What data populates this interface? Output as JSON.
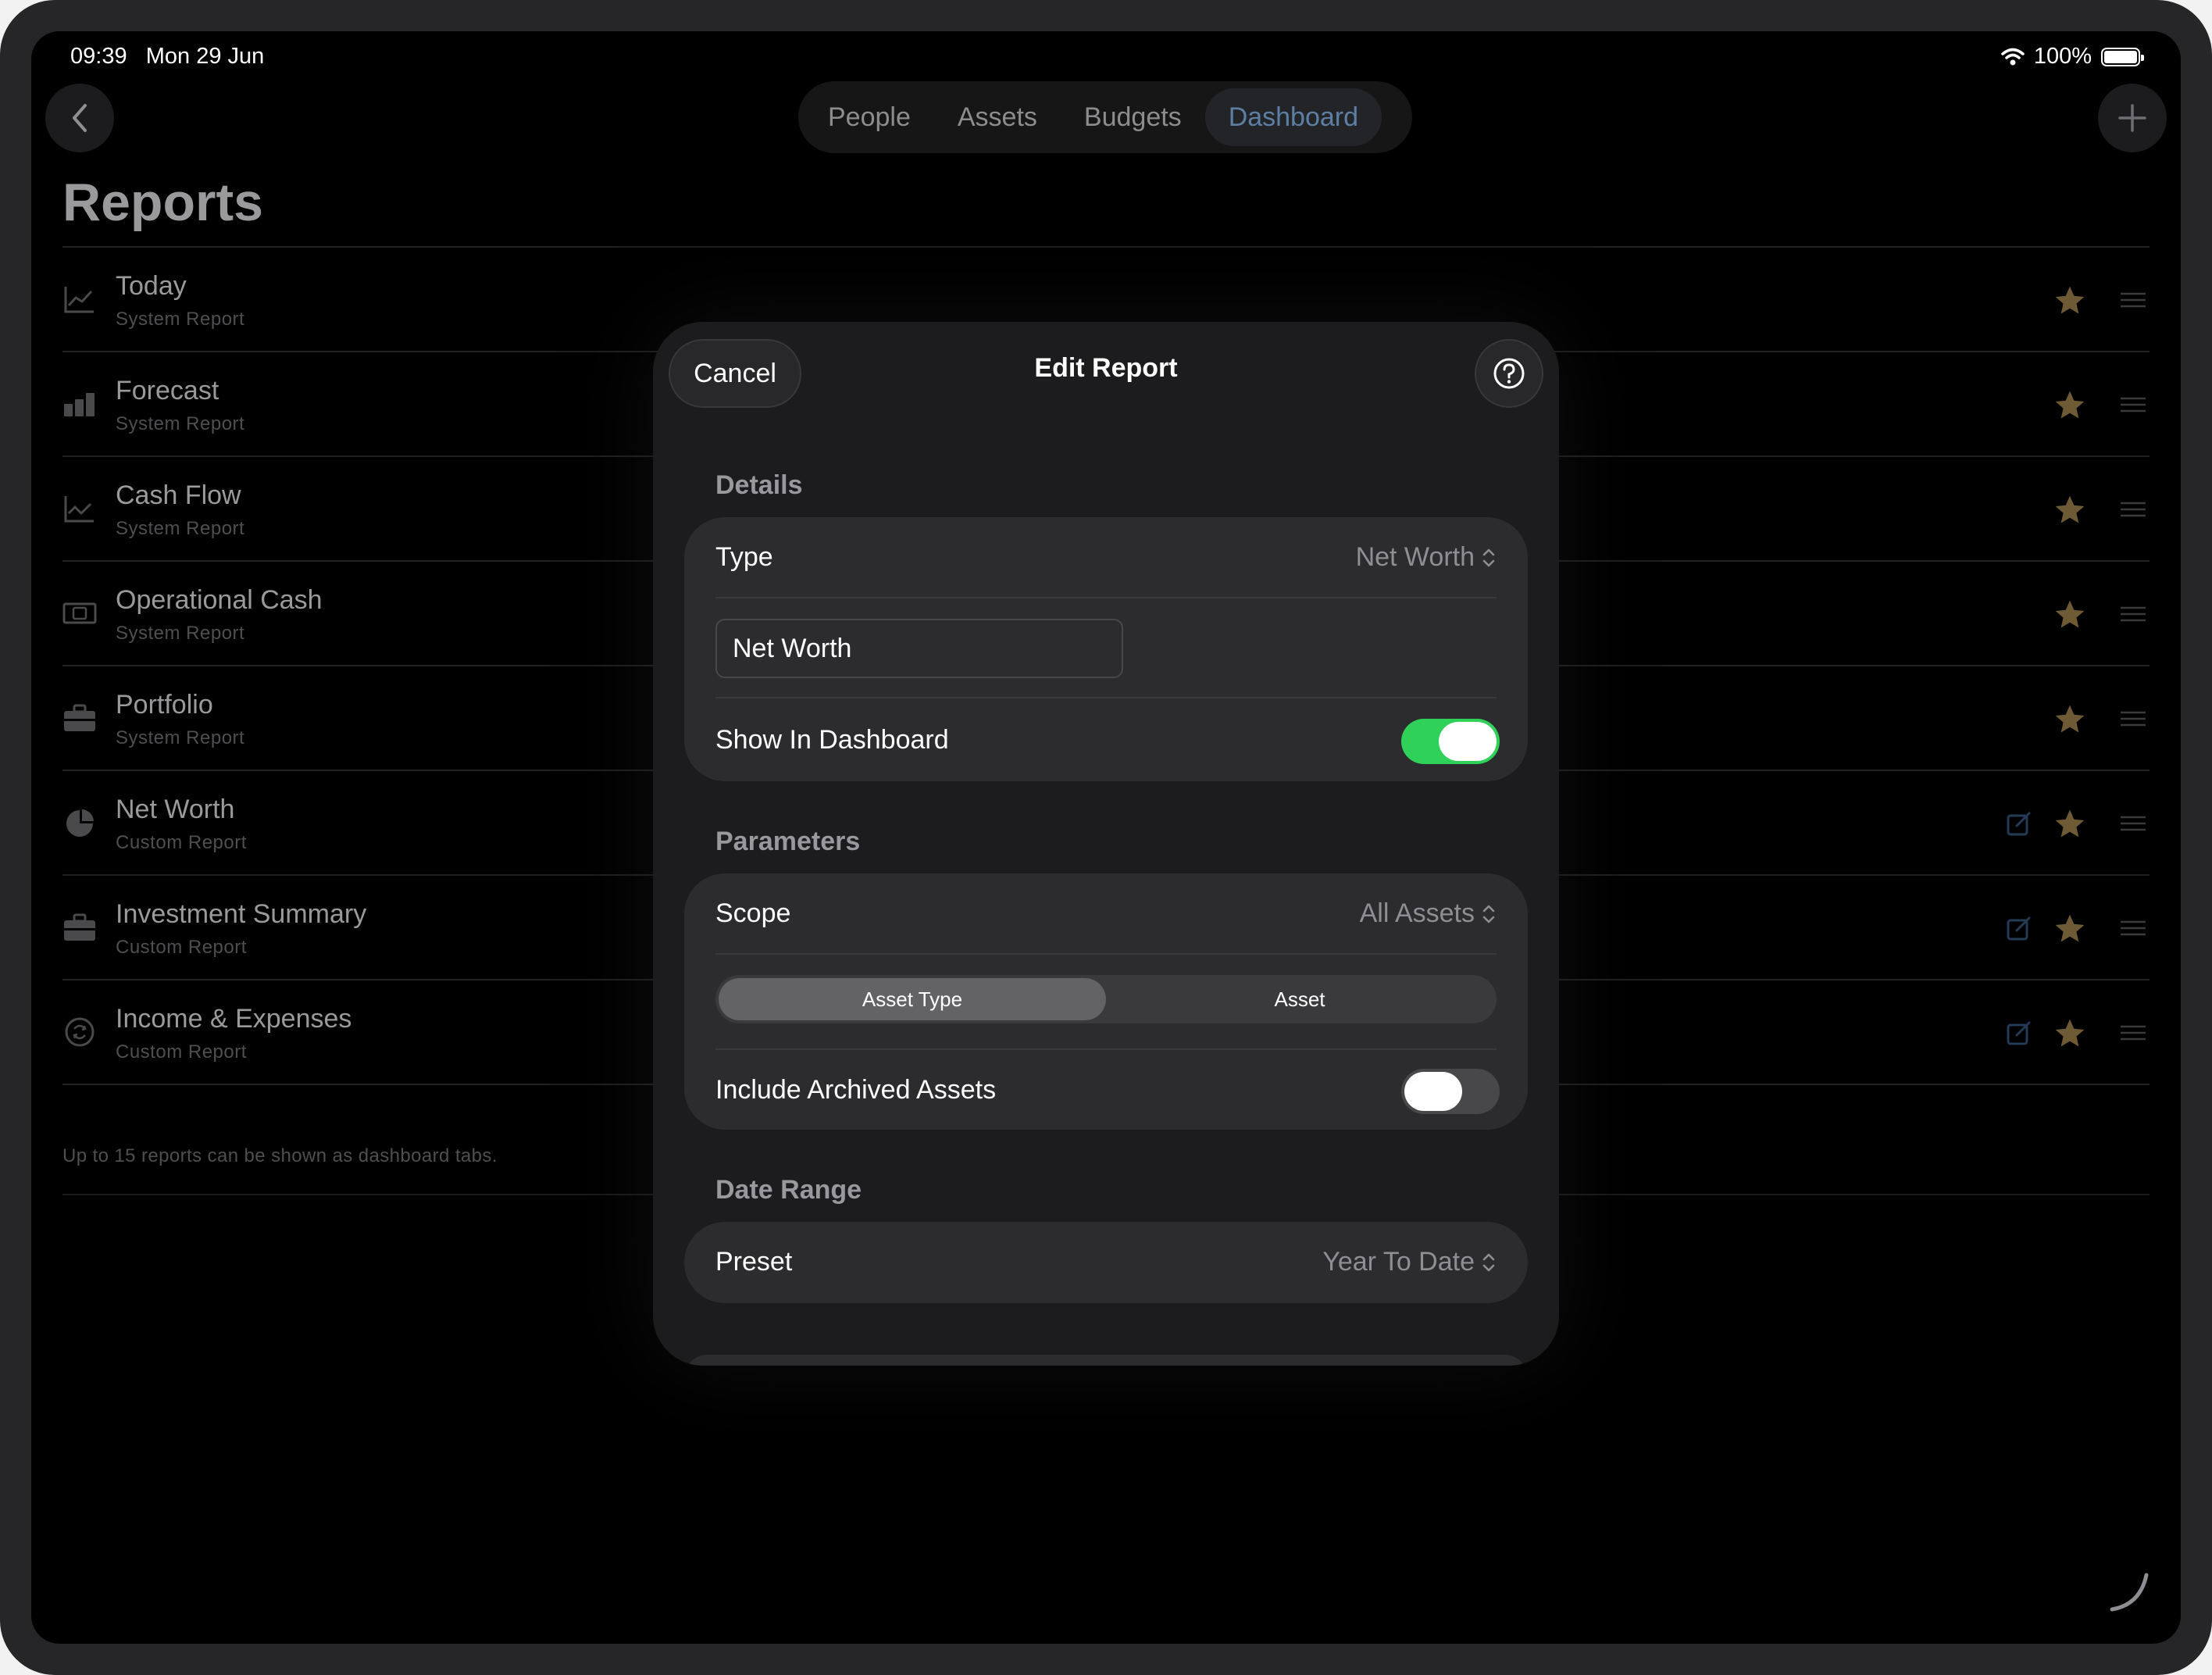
{
  "status": {
    "time": "09:39",
    "date": "Mon 29 Jun",
    "battery": "100%"
  },
  "nav": {
    "tabs": [
      {
        "label": "People",
        "active": false
      },
      {
        "label": "Assets",
        "active": false
      },
      {
        "label": "Budgets",
        "active": false
      },
      {
        "label": "Dashboard",
        "active": true
      }
    ]
  },
  "page": {
    "title": "Reports"
  },
  "reports": [
    {
      "title": "Today",
      "subtitle": "System Report",
      "icon": "line-chart-icon",
      "editable": false
    },
    {
      "title": "Forecast",
      "subtitle": "System Report",
      "icon": "bar-chart-icon",
      "editable": false
    },
    {
      "title": "Cash Flow",
      "subtitle": "System Report",
      "icon": "line-chart-icon",
      "editable": false
    },
    {
      "title": "Operational Cash",
      "subtitle": "System Report",
      "icon": "banknote-icon",
      "editable": false
    },
    {
      "title": "Portfolio",
      "subtitle": "System Report",
      "icon": "briefcase-icon",
      "editable": false
    },
    {
      "title": "Net Worth",
      "subtitle": "Custom Report",
      "icon": "pie-chart-icon",
      "editable": true
    },
    {
      "title": "Investment Summary",
      "subtitle": "Custom Report",
      "icon": "briefcase-icon",
      "editable": true
    },
    {
      "title": "Income & Expenses",
      "subtitle": "Custom Report",
      "icon": "currency-exchange-icon",
      "editable": true
    }
  ],
  "footnote": "Up to 15 reports can be shown as dashboard tabs.",
  "modal": {
    "cancel": "Cancel",
    "title": "Edit Report",
    "details": {
      "header": "Details",
      "type_label": "Type",
      "type_value": "Net Worth",
      "name_value": "Net Worth",
      "show_label": "Show In Dashboard",
      "show_on": true
    },
    "parameters": {
      "header": "Parameters",
      "scope_label": "Scope",
      "scope_value": "All Assets",
      "segments": [
        "Asset Type",
        "Asset"
      ],
      "selected_segment": "Asset Type",
      "archived_label": "Include Archived Assets",
      "archived_on": false
    },
    "date_range": {
      "header": "Date Range",
      "preset_label": "Preset",
      "preset_value": "Year To Date"
    }
  },
  "colors": {
    "toggle_on": "#30d158",
    "tab_active_text": "#5d7fa3",
    "star": "#6e5a34",
    "edit_icon": "#253a55"
  }
}
